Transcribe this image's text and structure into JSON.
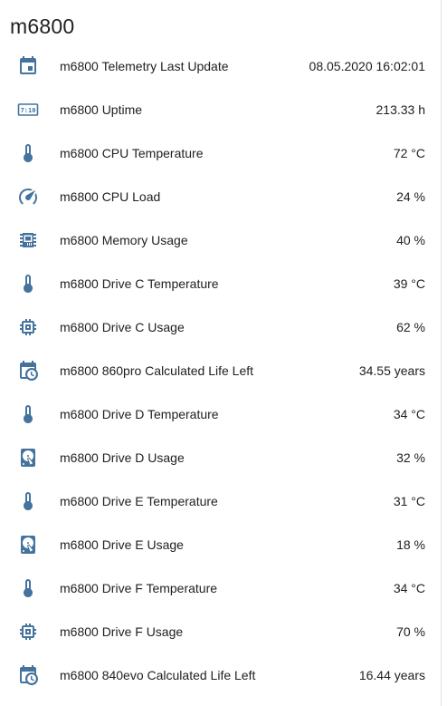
{
  "card": {
    "title": "m6800"
  },
  "colors": {
    "icon": "#44739e",
    "text": "#212121",
    "background": "#ffffff"
  },
  "entities": [
    {
      "icon": "calendar-icon",
      "label": "m6800 Telemetry Last Update",
      "value": "08.05.2020 16:02:01"
    },
    {
      "icon": "clock-digital-icon",
      "label": "m6800 Uptime",
      "value": "213.33 h"
    },
    {
      "icon": "thermometer-icon",
      "label": "m6800 CPU Temperature",
      "value": "72 °C"
    },
    {
      "icon": "gauge-icon",
      "label": "m6800 CPU Load",
      "value": "24 %"
    },
    {
      "icon": "chip-icon",
      "label": "m6800 Memory Usage",
      "value": "40 %"
    },
    {
      "icon": "thermometer-icon",
      "label": "m6800 Drive C Temperature",
      "value": "39 °C"
    },
    {
      "icon": "memory-icon",
      "label": "m6800 Drive C Usage",
      "value": "62 %"
    },
    {
      "icon": "calendar-clock-icon",
      "label": "m6800 860pro Calculated Life Left",
      "value": "34.55 years"
    },
    {
      "icon": "thermometer-icon",
      "label": "m6800 Drive D Temperature",
      "value": "34 °C"
    },
    {
      "icon": "harddisk-icon",
      "label": "m6800 Drive D Usage",
      "value": "32 %"
    },
    {
      "icon": "thermometer-icon",
      "label": "m6800 Drive E Temperature",
      "value": "31 °C"
    },
    {
      "icon": "harddisk-icon",
      "label": "m6800 Drive E Usage",
      "value": "18 %"
    },
    {
      "icon": "thermometer-icon",
      "label": "m6800 Drive F Temperature",
      "value": "34 °C"
    },
    {
      "icon": "memory-icon",
      "label": "m6800 Drive F Usage",
      "value": "70 %"
    },
    {
      "icon": "calendar-clock-icon",
      "label": "m6800 840evo Calculated Life Left",
      "value": "16.44 years"
    }
  ]
}
